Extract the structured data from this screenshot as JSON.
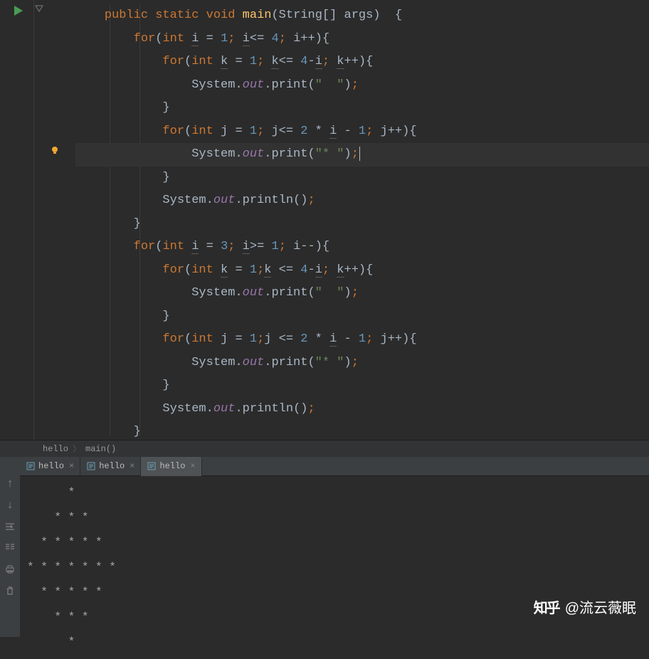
{
  "code": {
    "lines": [
      {
        "indent": 1,
        "tokens": [
          {
            "t": "public",
            "c": "kw"
          },
          {
            "t": " "
          },
          {
            "t": "static",
            "c": "kw"
          },
          {
            "t": " "
          },
          {
            "t": "void",
            "c": "kw"
          },
          {
            "t": " "
          },
          {
            "t": "main",
            "c": "method-name"
          },
          {
            "t": "(String[] args)  {"
          }
        ]
      },
      {
        "indent": 2,
        "tokens": [
          {
            "t": "for",
            "c": "kw"
          },
          {
            "t": "("
          },
          {
            "t": "int",
            "c": "kw"
          },
          {
            "t": " "
          },
          {
            "t": "i",
            "c": "var-u"
          },
          {
            "t": " = "
          },
          {
            "t": "1",
            "c": "num"
          },
          {
            "t": "; ",
            "c": "semi"
          },
          {
            "t": "i",
            "c": "var-u"
          },
          {
            "t": "<= "
          },
          {
            "t": "4",
            "c": "num"
          },
          {
            "t": "; ",
            "c": "semi"
          },
          {
            "t": "i++){"
          }
        ]
      },
      {
        "indent": 3,
        "tokens": [
          {
            "t": "for",
            "c": "kw"
          },
          {
            "t": "("
          },
          {
            "t": "int",
            "c": "kw"
          },
          {
            "t": " "
          },
          {
            "t": "k",
            "c": "var-u"
          },
          {
            "t": " = "
          },
          {
            "t": "1",
            "c": "num"
          },
          {
            "t": "; ",
            "c": "semi"
          },
          {
            "t": "k",
            "c": "var-u"
          },
          {
            "t": "<= "
          },
          {
            "t": "4",
            "c": "num"
          },
          {
            "t": "-"
          },
          {
            "t": "i",
            "c": "var-u"
          },
          {
            "t": "; ",
            "c": "semi"
          },
          {
            "t": "k",
            "c": "var-u"
          },
          {
            "t": "++){"
          }
        ]
      },
      {
        "indent": 4,
        "tokens": [
          {
            "t": "System."
          },
          {
            "t": "out",
            "c": "field"
          },
          {
            "t": ".print("
          },
          {
            "t": "\"  \"",
            "c": "str"
          },
          {
            "t": ")"
          },
          {
            "t": ";",
            "c": "semi"
          }
        ]
      },
      {
        "indent": 3,
        "tokens": [
          {
            "t": "}"
          }
        ]
      },
      {
        "indent": 3,
        "tokens": [
          {
            "t": "for",
            "c": "kw"
          },
          {
            "t": "("
          },
          {
            "t": "int",
            "c": "kw"
          },
          {
            "t": " j = "
          },
          {
            "t": "1",
            "c": "num"
          },
          {
            "t": "; ",
            "c": "semi"
          },
          {
            "t": "j<= "
          },
          {
            "t": "2",
            "c": "num"
          },
          {
            "t": " * "
          },
          {
            "t": "i",
            "c": "var-u"
          },
          {
            "t": " - "
          },
          {
            "t": "1",
            "c": "num"
          },
          {
            "t": "; ",
            "c": "semi"
          },
          {
            "t": "j++){"
          }
        ]
      },
      {
        "indent": 4,
        "highlight": true,
        "cursor": true,
        "tokens": [
          {
            "t": "System."
          },
          {
            "t": "out",
            "c": "field"
          },
          {
            "t": ".print("
          },
          {
            "t": "\"* \"",
            "c": "str"
          },
          {
            "t": ")"
          },
          {
            "t": ";",
            "c": "semi"
          }
        ]
      },
      {
        "indent": 3,
        "tokens": [
          {
            "t": "}"
          }
        ]
      },
      {
        "indent": 3,
        "tokens": [
          {
            "t": "System."
          },
          {
            "t": "out",
            "c": "field"
          },
          {
            "t": ".println()"
          },
          {
            "t": ";",
            "c": "semi"
          }
        ]
      },
      {
        "indent": 2,
        "tokens": [
          {
            "t": "}"
          }
        ]
      },
      {
        "indent": 2,
        "tokens": [
          {
            "t": "for",
            "c": "kw"
          },
          {
            "t": "("
          },
          {
            "t": "int",
            "c": "kw"
          },
          {
            "t": " "
          },
          {
            "t": "i",
            "c": "var-u"
          },
          {
            "t": " = "
          },
          {
            "t": "3",
            "c": "num"
          },
          {
            "t": "; ",
            "c": "semi"
          },
          {
            "t": "i",
            "c": "var-u"
          },
          {
            "t": ">= "
          },
          {
            "t": "1",
            "c": "num"
          },
          {
            "t": "; ",
            "c": "semi"
          },
          {
            "t": "i--){"
          }
        ]
      },
      {
        "indent": 3,
        "tokens": [
          {
            "t": "for",
            "c": "kw"
          },
          {
            "t": "("
          },
          {
            "t": "int",
            "c": "kw"
          },
          {
            "t": " "
          },
          {
            "t": "k",
            "c": "var-u"
          },
          {
            "t": " = "
          },
          {
            "t": "1",
            "c": "num"
          },
          {
            "t": ";",
            "c": "semi"
          },
          {
            "t": "k",
            "c": "var-u"
          },
          {
            "t": " <= "
          },
          {
            "t": "4",
            "c": "num"
          },
          {
            "t": "-"
          },
          {
            "t": "i",
            "c": "var-u"
          },
          {
            "t": "; ",
            "c": "semi"
          },
          {
            "t": "k",
            "c": "var-u"
          },
          {
            "t": "++){"
          }
        ]
      },
      {
        "indent": 4,
        "tokens": [
          {
            "t": "System."
          },
          {
            "t": "out",
            "c": "field"
          },
          {
            "t": ".print("
          },
          {
            "t": "\"  \"",
            "c": "str"
          },
          {
            "t": ")"
          },
          {
            "t": ";",
            "c": "semi"
          }
        ]
      },
      {
        "indent": 3,
        "tokens": [
          {
            "t": "}"
          }
        ]
      },
      {
        "indent": 3,
        "tokens": [
          {
            "t": "for",
            "c": "kw"
          },
          {
            "t": "("
          },
          {
            "t": "int",
            "c": "kw"
          },
          {
            "t": " j = "
          },
          {
            "t": "1",
            "c": "num"
          },
          {
            "t": ";",
            "c": "semi"
          },
          {
            "t": "j <= "
          },
          {
            "t": "2",
            "c": "num"
          },
          {
            "t": " * "
          },
          {
            "t": "i",
            "c": "var-u"
          },
          {
            "t": " - "
          },
          {
            "t": "1",
            "c": "num"
          },
          {
            "t": "; ",
            "c": "semi"
          },
          {
            "t": "j++){"
          }
        ]
      },
      {
        "indent": 4,
        "tokens": [
          {
            "t": "System."
          },
          {
            "t": "out",
            "c": "field"
          },
          {
            "t": ".print("
          },
          {
            "t": "\"* \"",
            "c": "str"
          },
          {
            "t": ")"
          },
          {
            "t": ";",
            "c": "semi"
          }
        ]
      },
      {
        "indent": 3,
        "tokens": [
          {
            "t": "}"
          }
        ]
      },
      {
        "indent": 3,
        "tokens": [
          {
            "t": "System."
          },
          {
            "t": "out",
            "c": "field"
          },
          {
            "t": ".println()"
          },
          {
            "t": ";",
            "c": "semi"
          }
        ]
      },
      {
        "indent": 2,
        "tokens": [
          {
            "t": "}"
          }
        ]
      }
    ]
  },
  "breadcrumb": {
    "items": [
      "hello",
      "main()"
    ]
  },
  "tabs": [
    {
      "label": "hello",
      "active": false
    },
    {
      "label": "hello",
      "active": false
    },
    {
      "label": "hello",
      "active": true
    }
  ],
  "console_output": "      * \n    * * * \n  * * * * * \n* * * * * * * \n  * * * * * \n    * * * \n      * ",
  "watermark": {
    "logo": "知乎",
    "text": "@流云薇眠"
  }
}
